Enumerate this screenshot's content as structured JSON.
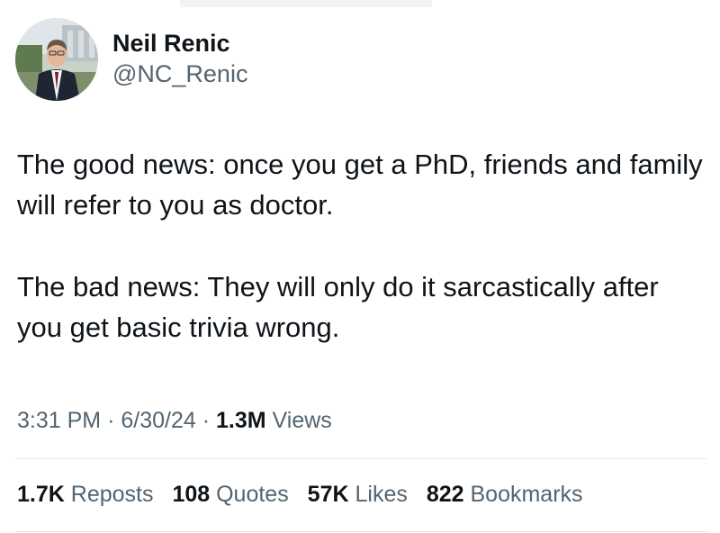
{
  "author": {
    "display_name": "Neil Renic",
    "handle": "@NC_Renic",
    "avatar": "profile-photo"
  },
  "tweet": {
    "paragraphs": [
      "The good news: once you get a PhD, friends and family will refer to you as doctor.",
      "The bad news: They will only do it sarcastically after you get basic trivia wrong."
    ],
    "time": "3:31 PM",
    "date": "6/30/24",
    "separator": "·",
    "views_count": "1.3M",
    "views_label": "Views"
  },
  "stats": {
    "reposts": {
      "count": "1.7K",
      "label": "Reposts"
    },
    "quotes": {
      "count": "108",
      "label": "Quotes"
    },
    "likes": {
      "count": "57K",
      "label": "Likes"
    },
    "bookmarks": {
      "count": "822",
      "label": "Bookmarks"
    }
  },
  "colors": {
    "text": "#0f1419",
    "secondary": "#536471",
    "divider": "#e1e8ed",
    "background": "#ffffff"
  }
}
